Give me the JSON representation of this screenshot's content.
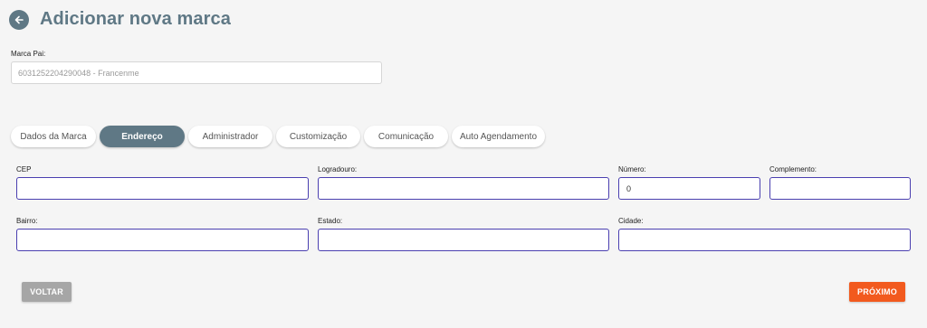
{
  "header": {
    "title": "Adicionar nova marca",
    "back_icon": "arrow-left-icon"
  },
  "parent_brand": {
    "label": "Marca Pai:",
    "value": "6031252204290048 - Francenme"
  },
  "tabs": [
    {
      "label": "Dados da Marca",
      "active": false
    },
    {
      "label": "Endereço",
      "active": true
    },
    {
      "label": "Administrador",
      "active": false
    },
    {
      "label": "Customização",
      "active": false
    },
    {
      "label": "Comunicação",
      "active": false
    },
    {
      "label": "Auto Agendamento",
      "active": false
    }
  ],
  "form": {
    "cep": {
      "label": "CEP",
      "value": ""
    },
    "logradouro": {
      "label": "Logradouro:",
      "value": ""
    },
    "numero": {
      "label": "Número:",
      "value": "0"
    },
    "complemento": {
      "label": "Complemento:",
      "value": ""
    },
    "bairro": {
      "label": "Bairro:",
      "value": ""
    },
    "estado": {
      "label": "Estado:",
      "value": ""
    },
    "cidade": {
      "label": "Cidade:",
      "value": ""
    }
  },
  "actions": {
    "back_label": "VOLTAR",
    "next_label": "PRÓXIMO"
  },
  "colors": {
    "primary": "#5f7885",
    "accent": "#f25a1e",
    "input_border": "#4a3fb0",
    "disabled": "#a6a6a6"
  }
}
